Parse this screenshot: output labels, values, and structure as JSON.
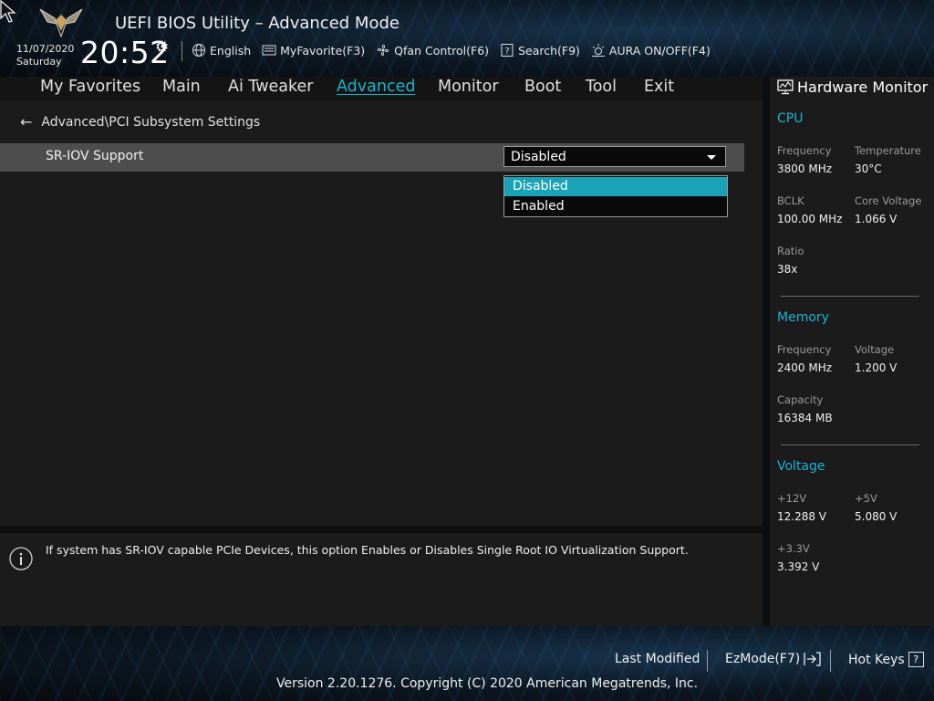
{
  "header": {
    "title": "UEFI BIOS Utility – Advanced Mode",
    "date": "11/07/2020",
    "day": "Saturday",
    "time": "20:52",
    "tools": [
      {
        "label": "English",
        "icon": "globe-icon"
      },
      {
        "label": "MyFavorite(F3)",
        "icon": "myfavorite-icon"
      },
      {
        "label": "Qfan Control(F6)",
        "icon": "fan-icon"
      },
      {
        "label": "Search(F9)",
        "icon": "search-icon"
      },
      {
        "label": "AURA ON/OFF(F4)",
        "icon": "aura-icon"
      }
    ]
  },
  "nav": {
    "tabs": [
      "My Favorites",
      "Main",
      "Ai Tweaker",
      "Advanced",
      "Monitor",
      "Boot",
      "Tool",
      "Exit"
    ],
    "active": "Advanced"
  },
  "main": {
    "breadcrumb": "Advanced\\PCI Subsystem Settings",
    "setting": {
      "label": "SR-IOV Support",
      "value": "Disabled",
      "options": [
        "Disabled",
        "Enabled"
      ],
      "highlighted_option": "Disabled"
    }
  },
  "help": {
    "text": "If system has SR-IOV capable PCIe Devices, this option Enables or Disables Single Root IO Virtualization Support."
  },
  "hardware_monitor": {
    "title": "Hardware Monitor",
    "cpu": {
      "title": "CPU",
      "frequency_label": "Frequency",
      "frequency": "3800 MHz",
      "temperature_label": "Temperature",
      "temperature": "30°C",
      "bclk_label": "BCLK",
      "bclk": "100.00 MHz",
      "core_voltage_label": "Core Voltage",
      "core_voltage": "1.066 V",
      "ratio_label": "Ratio",
      "ratio": "38x"
    },
    "memory": {
      "title": "Memory",
      "frequency_label": "Frequency",
      "frequency": "2400 MHz",
      "voltage_label": "Voltage",
      "voltage": "1.200 V",
      "capacity_label": "Capacity",
      "capacity": "16384 MB"
    },
    "voltage": {
      "title": "Voltage",
      "v12_label": "+12V",
      "v12": "12.288 V",
      "v5_label": "+5V",
      "v5": "5.080 V",
      "v33_label": "+3.3V",
      "v33": "3.392 V"
    }
  },
  "footer": {
    "last_modified": "Last Modified",
    "ezmode": "EzMode(F7)",
    "hotkeys": "Hot Keys",
    "hotkeys_glyph": "?",
    "copyright": "Version 2.20.1276. Copyright (C) 2020 American Megatrends, Inc."
  },
  "colors": {
    "accent": "#19b4d2",
    "selected_option_bg": "#1aa3b8",
    "panel_bg": "#1b1b1b",
    "row_bg": "#4d4d4d"
  }
}
